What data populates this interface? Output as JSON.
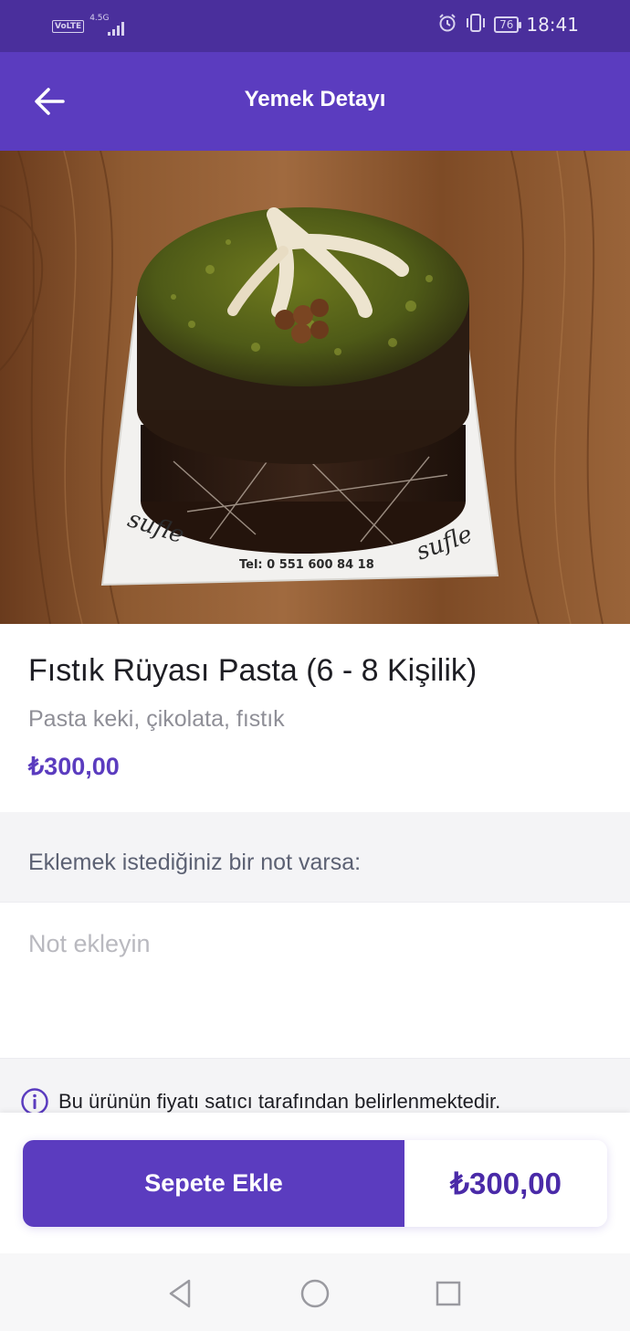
{
  "status_bar": {
    "volte": "VoLTE",
    "network": "4.5G",
    "battery": "76",
    "time": "18:41"
  },
  "header": {
    "title": "Yemek Detayı"
  },
  "hero": {
    "board_brand": "sufle",
    "board_phone": "Tel: 0 551 600 84 18"
  },
  "product": {
    "name": "Fıstık Rüyası Pasta (6 - 8 Kişilik)",
    "description": "Pasta keki, çikolata, fıstık",
    "price": "₺300,00"
  },
  "note": {
    "label": "Eklemek istediğiniz bir not varsa:",
    "placeholder": "Not ekleyin"
  },
  "info": {
    "text": "Bu ürünün fiyatı satıcı tarafından belirlenmektedir."
  },
  "cart": {
    "add_label": "Sepete Ekle",
    "total": "₺300,00"
  },
  "colors": {
    "brand": "#5b3cbf",
    "status_bar": "#4a2f9c"
  }
}
